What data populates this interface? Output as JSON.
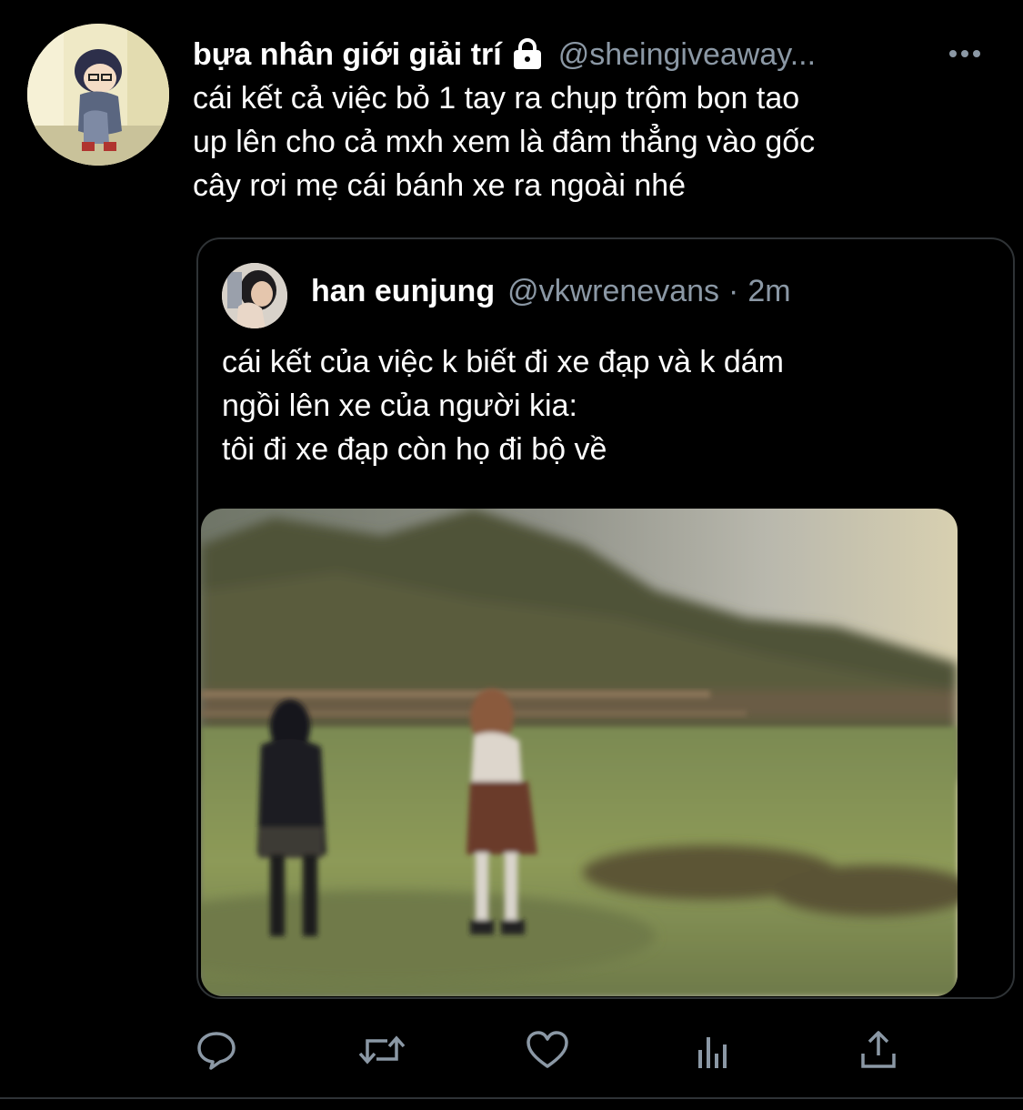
{
  "tweet": {
    "display_name": "bựa nhân giới giải trí",
    "handle": "@sheingiveaway...",
    "text": "cái kết cả việc bỏ 1 tay ra chụp trộm bọn tao\nup lên cho cả mxh xem là đâm thẳng vào gốc\ncây rơi mẹ cái bánh xe ra ngoài nhé",
    "protected": true,
    "avatar_icon": "anime-character-avatar",
    "more_icon": "more-dots-icon"
  },
  "quote": {
    "display_name": "han eunjung",
    "handle": "@vkwrenevans",
    "separator": "·",
    "time": "2m",
    "text": "cái kết của việc k biết đi xe đạp và k dám\nngồi lên xe của người kia:\ntôi đi xe đạp còn họ đi bộ về",
    "image_icon": "blurry-photo-two-people-walking-field"
  },
  "actions": [
    {
      "name": "reply",
      "icon": "comment-icon"
    },
    {
      "name": "retweet",
      "icon": "retweet-icon"
    },
    {
      "name": "like",
      "icon": "heart-icon"
    },
    {
      "name": "analytics",
      "icon": "analytics-icon"
    },
    {
      "name": "share",
      "icon": "share-icon"
    }
  ],
  "colors": {
    "background": "#000000",
    "text_primary": "#ffffff",
    "text_secondary": "#8b98a5",
    "border": "#2f3336",
    "action_icon": "#8b98a5"
  }
}
